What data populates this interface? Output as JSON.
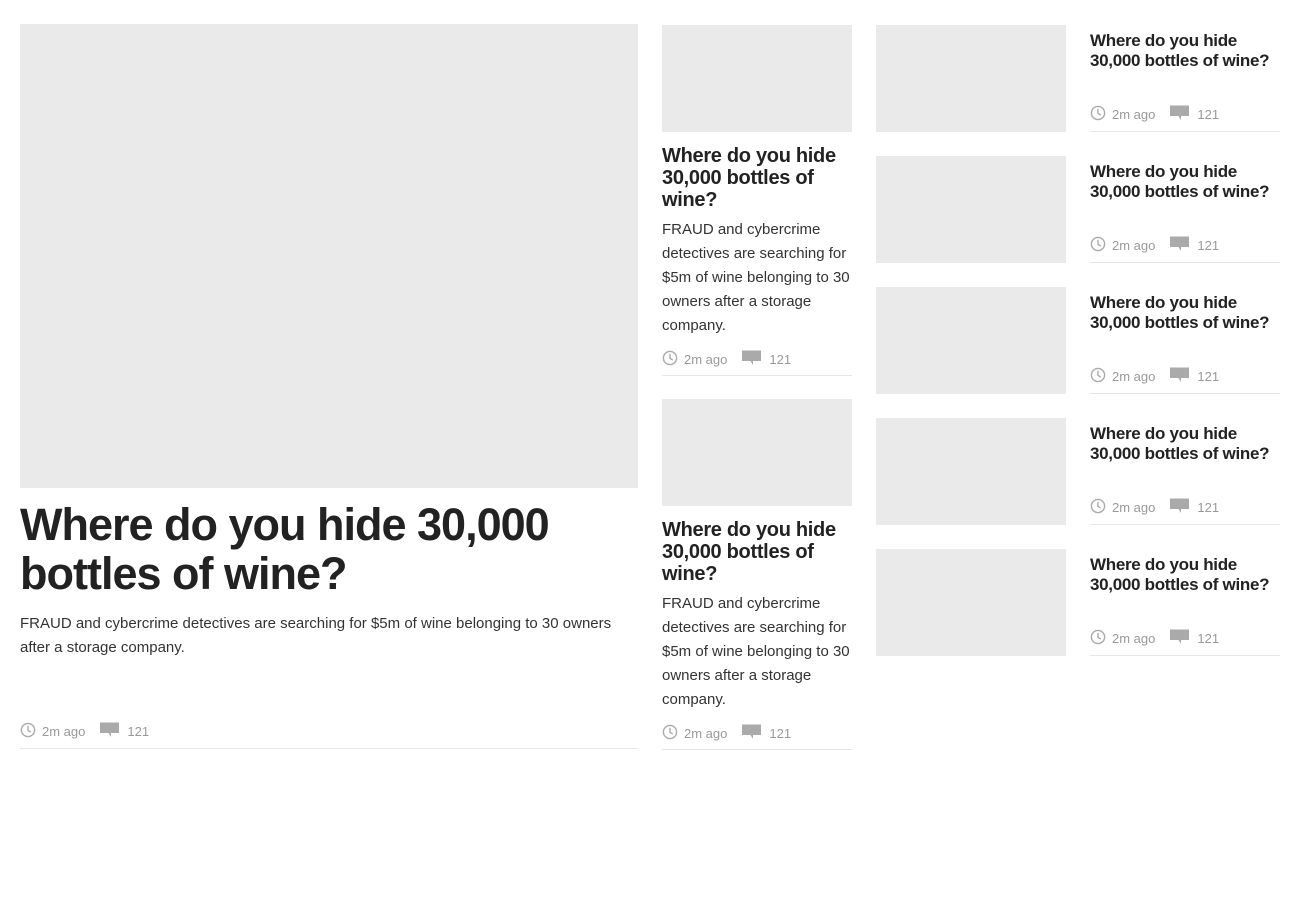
{
  "hero": {
    "title": "Where do you hide 30,000 bottles of wine?",
    "summary": "FRAUD and cybercrime detectives are searching for $5m of wine belonging to 30 owners after a storage company.",
    "time": "2m ago",
    "comments": "121"
  },
  "middle": [
    {
      "title": "Where do you hide 30,000 bottles of wine?",
      "summary": "FRAUD and cybercrime detectives are searching for $5m of wine belonging to 30 owners after a storage company.",
      "time": "2m ago",
      "comments": "121"
    },
    {
      "title": "Where do you hide 30,000 bottles of wine?",
      "summary": "FRAUD and cybercrime detectives are searching for $5m of wine belonging to 30 owners after a storage company.",
      "time": "2m ago",
      "comments": "121"
    }
  ],
  "list": [
    {
      "title": "Where do you hide 30,000 bottles of wine?",
      "time": "2m ago",
      "comments": "121"
    },
    {
      "title": "Where do you hide 30,000 bottles of wine?",
      "time": "2m ago",
      "comments": "121"
    },
    {
      "title": "Where do you hide 30,000 bottles of wine?",
      "time": "2m ago",
      "comments": "121"
    },
    {
      "title": "Where do you hide 30,000 bottles of wine?",
      "time": "2m ago",
      "comments": "121"
    },
    {
      "title": "Where do you hide 30,000 bottles of wine?",
      "time": "2m ago",
      "comments": "121"
    }
  ],
  "icons": {
    "time": "clock-icon",
    "comments": "comment-bubble-icon"
  },
  "colors": {
    "placeholder": "#eaeaea",
    "meta_text": "#999999",
    "divider": "#e6e6e6",
    "heading": "#222222"
  }
}
